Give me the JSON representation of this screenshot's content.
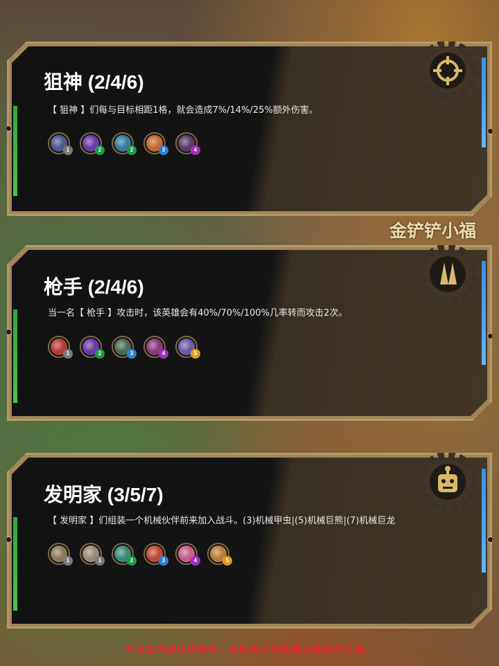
{
  "watermark": "金铲铲小福",
  "footer": "本页面内容仅供参考，实际弈子和效果以游戏内为准。",
  "colors": {
    "border": "#b79b66",
    "green": "#2fa83a",
    "blue": "#3a8fe0",
    "footer": "#e8242b"
  },
  "traits": [
    {
      "title": "狙神 (2/4/6)",
      "description": "【 狙神 】们每与目标相距1格，就会造成7%/14%/25%额外伤害。",
      "icon": "crosshair-icon",
      "champions": [
        {
          "cost": "1",
          "color": "#4a5a8a"
        },
        {
          "cost": "2",
          "color": "#6a3aa8"
        },
        {
          "cost": "2",
          "color": "#3a7a9a"
        },
        {
          "cost": "3",
          "color": "#c06a30"
        },
        {
          "cost": "4",
          "color": "#5a3a6a"
        }
      ]
    },
    {
      "title": "枪手 (2/4/6)",
      "description": "当一名【 枪手 】攻击时，该英雄会有40%/70%/100%几率转而攻击2次。",
      "icon": "bullets-icon",
      "champions": [
        {
          "cost": "1",
          "color": "#b83a3a"
        },
        {
          "cost": "2",
          "color": "#6a3aa8"
        },
        {
          "cost": "3",
          "color": "#4a6a5a"
        },
        {
          "cost": "4",
          "color": "#8a3a7a"
        },
        {
          "cost": "5",
          "color": "#6a5aa8"
        }
      ]
    },
    {
      "title": "发明家 (3/5/7)",
      "description": "【 发明家 】们组装一个机械伙伴前来加入战斗。(3)机械甲虫|(5)机械巨熊|(7)机械巨龙",
      "icon": "robot-icon",
      "champions": [
        {
          "cost": "1",
          "color": "#8a7a5a"
        },
        {
          "cost": "1",
          "color": "#9a8a7a"
        },
        {
          "cost": "2",
          "color": "#3a8a7a"
        },
        {
          "cost": "3",
          "color": "#c04a3a"
        },
        {
          "cost": "4",
          "color": "#c85a8a"
        },
        {
          "cost": "5",
          "color": "#b87a3a"
        }
      ]
    }
  ]
}
